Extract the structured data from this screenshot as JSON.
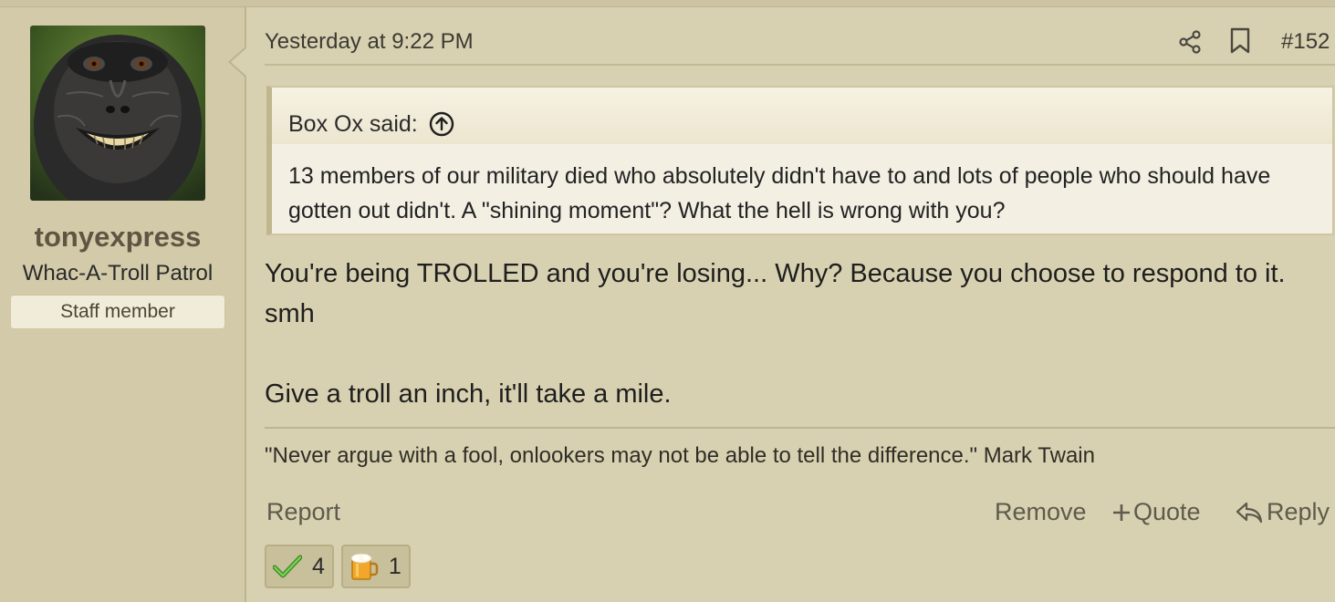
{
  "post": {
    "date": "Yesterday at 9:22 PM",
    "post_number": "#152",
    "author": {
      "username": "tonyexpress",
      "user_title": "Whac-A-Troll Patrol",
      "badge": "Staff member"
    },
    "quote": {
      "header": "Box Ox said:",
      "body": "13 members of our military died who absolutely didn't have to and lots of people who should have gotten out didn't. A \"shining moment\"? What the hell is wrong with you?"
    },
    "message": {
      "paragraph1": "You're being TROLLED and you're losing... Why? Because you choose to respond to it. smh",
      "paragraph2": "Give a troll an inch, it'll take a mile."
    },
    "signature": "\"Never argue with a fool, onlookers may not be able to tell the difference.\" Mark Twain",
    "actions": {
      "report": "Report",
      "remove": "Remove",
      "quote": "Quote",
      "reply": "Reply"
    },
    "reactions": [
      {
        "icon": "checkmark-icon",
        "count": "4"
      },
      {
        "icon": "beer-mug-icon",
        "count": "1"
      }
    ]
  },
  "colors": {
    "background": "#d8d1b1",
    "sidebar": "#d2caa8",
    "username": "#5e5642",
    "quote_bg": "#f3efe3",
    "link": "#5e5a4c"
  }
}
